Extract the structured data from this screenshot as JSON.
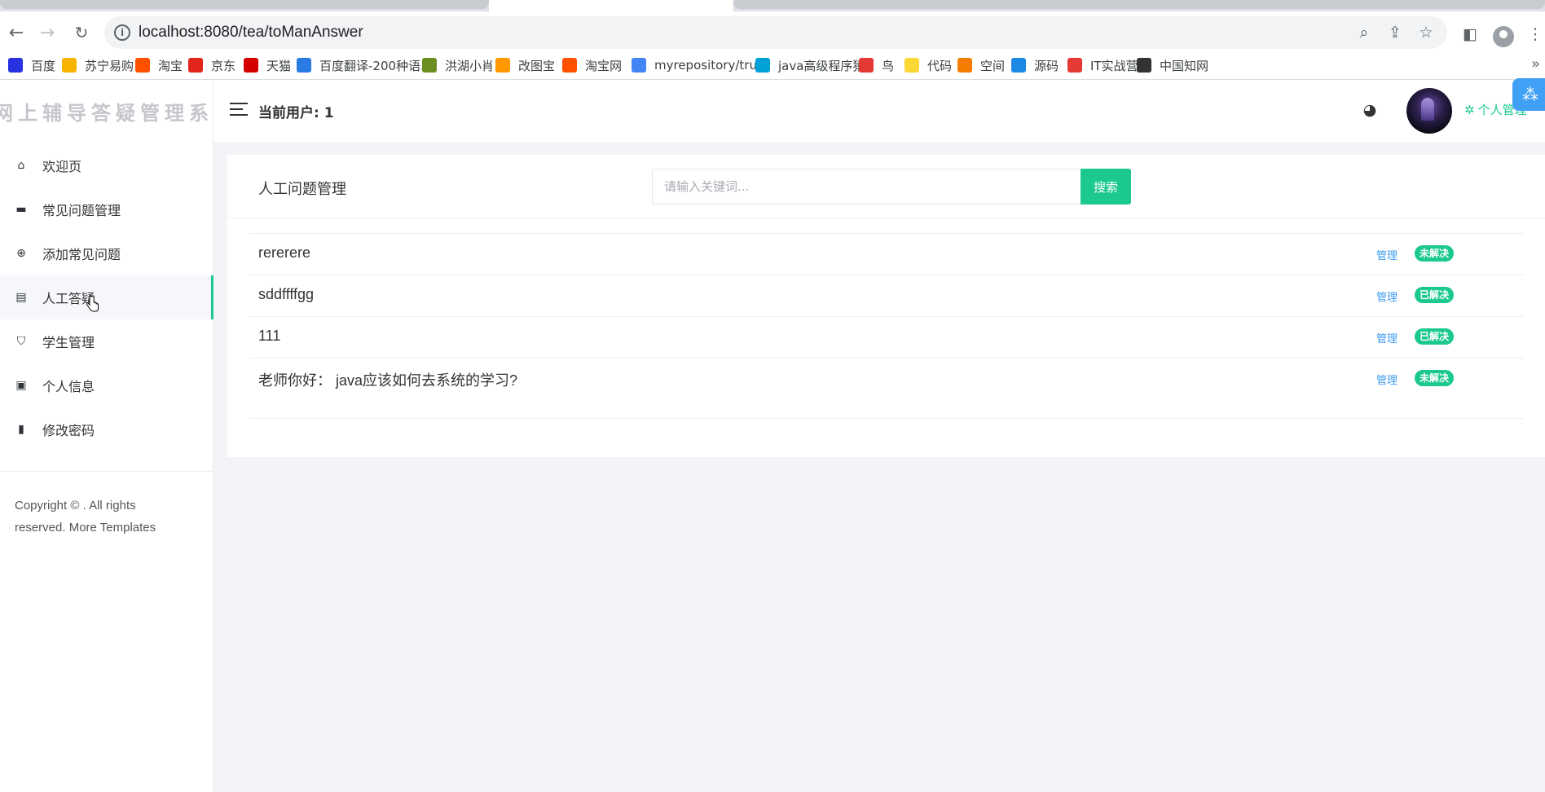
{
  "browser": {
    "url": "localhost:8080/tea/toManAnswer",
    "bookmarks": [
      {
        "label": "百度",
        "icon": "baidu-icon",
        "color": "#2932e1"
      },
      {
        "label": "苏宁易购",
        "icon": "suning-icon",
        "color": "#f6b400"
      },
      {
        "label": "淘宝",
        "icon": "taobao-icon",
        "color": "#ff5000"
      },
      {
        "label": "京东",
        "icon": "jd-icon",
        "color": "#e1251b"
      },
      {
        "label": "天猫",
        "icon": "tmall-icon",
        "color": "#d40000"
      },
      {
        "label": "百度翻译-200种语...",
        "icon": "translate-icon",
        "color": "#2a7ae4"
      },
      {
        "label": "洪湖小肖",
        "icon": "bird-icon",
        "color": "#6b8e23"
      },
      {
        "label": "改图宝",
        "icon": "gaitubao-icon",
        "color": "#ff9800"
      },
      {
        "label": "淘宝网",
        "icon": "taobao-icon",
        "color": "#ff5000"
      },
      {
        "label": "myrepository/tru...",
        "icon": "chrome-icon",
        "color": "#4285f4"
      },
      {
        "label": "java高级程序猿",
        "icon": "bilibili-icon",
        "color": "#00a1d6"
      },
      {
        "label": "鸟",
        "icon": "bird-red-icon",
        "color": "#e53935"
      },
      {
        "label": "代码",
        "icon": "code-icon",
        "color": "#fdd835"
      },
      {
        "label": "空间",
        "icon": "space-icon",
        "color": "#f57c00"
      },
      {
        "label": "源码",
        "icon": "docker-icon",
        "color": "#1e88e5"
      },
      {
        "label": "IT实战营",
        "icon": "chrome-icon",
        "color": "#e53935"
      },
      {
        "label": "中国知网",
        "icon": "cnki-icon",
        "color": "#333333"
      }
    ]
  },
  "sidebar": {
    "logo": "网上辅导答疑管理系统",
    "items": [
      {
        "label": "欢迎页",
        "icon": "home-icon"
      },
      {
        "label": "常见问题管理",
        "icon": "comment-icon"
      },
      {
        "label": "添加常见问题",
        "icon": "plus-circle-icon"
      },
      {
        "label": "人工答疑",
        "icon": "message-icon"
      },
      {
        "label": "学生管理",
        "icon": "shield-check-icon"
      },
      {
        "label": "个人信息",
        "icon": "contact-card-icon"
      },
      {
        "label": "修改密码",
        "icon": "lock-icon"
      }
    ],
    "active_index": 3,
    "copyright_line1": "Copyright © . All rights",
    "copyright_line2": "reserved. More Templates"
  },
  "header": {
    "current_user": "当前用户: 1",
    "personal_menu": "个人管理"
  },
  "main": {
    "title": "人工问题管理",
    "search": {
      "placeholder": "请输入关键词...",
      "button": "搜索"
    },
    "questions": [
      {
        "title": "rererere",
        "manage": "管理",
        "status": "未解决"
      },
      {
        "title": "sddffffgg",
        "manage": "管理",
        "status": "已解决"
      },
      {
        "title": "111",
        "manage": "管理",
        "status": "已解决"
      },
      {
        "title": "老师你好： java应该如何去系统的学习?",
        "manage": "管理",
        "status": "未解决"
      }
    ]
  },
  "colors": {
    "accent": "#1bc98e",
    "link": "#3d9bf0"
  }
}
